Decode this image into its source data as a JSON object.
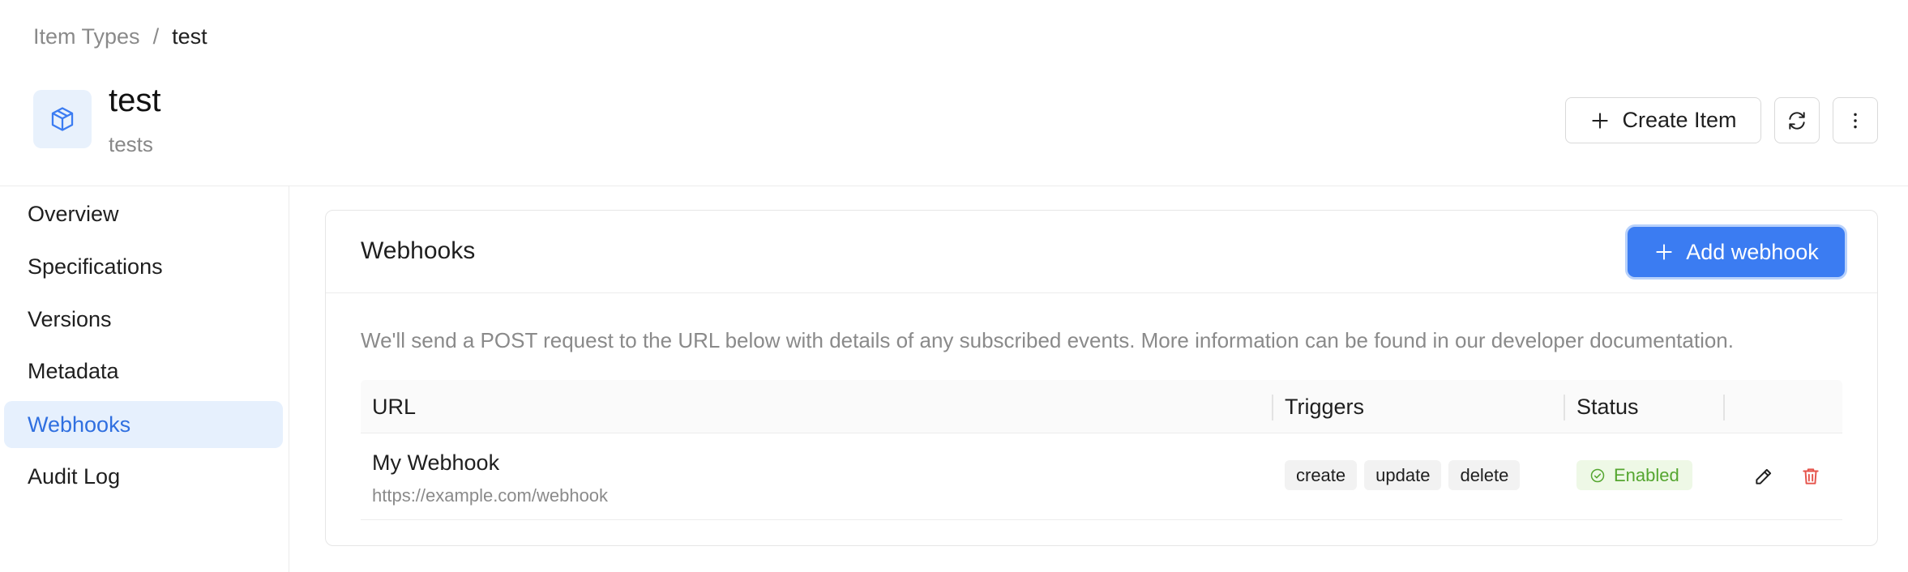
{
  "breadcrumb": {
    "parent": "Item Types",
    "separator": "/",
    "current": "test"
  },
  "item_type": {
    "title": "test",
    "subtitle": "tests",
    "icon": "cube-icon"
  },
  "header_actions": {
    "create_label": "Create Item"
  },
  "sidebar": {
    "items": [
      {
        "label": "Overview"
      },
      {
        "label": "Specifications"
      },
      {
        "label": "Versions"
      },
      {
        "label": "Metadata"
      },
      {
        "label": "Webhooks",
        "active": true
      },
      {
        "label": "Audit Log"
      }
    ]
  },
  "webhooks": {
    "title": "Webhooks",
    "add_label": "Add webhook",
    "description": "We'll send a POST request to the URL below with details of any subscribed events. More information can be found in our developer documentation.",
    "columns": {
      "url": "URL",
      "triggers": "Triggers",
      "status": "Status"
    },
    "rows": [
      {
        "name": "My Webhook",
        "url": "https://example.com/webhook",
        "triggers": [
          "create",
          "update",
          "delete"
        ],
        "status": "Enabled"
      }
    ]
  },
  "colors": {
    "accent": "#3b7cf2",
    "active_bg": "#e6f0fd",
    "enabled_text": "#55a630",
    "enabled_bg": "#eef8e6",
    "delete": "#e5534b"
  }
}
